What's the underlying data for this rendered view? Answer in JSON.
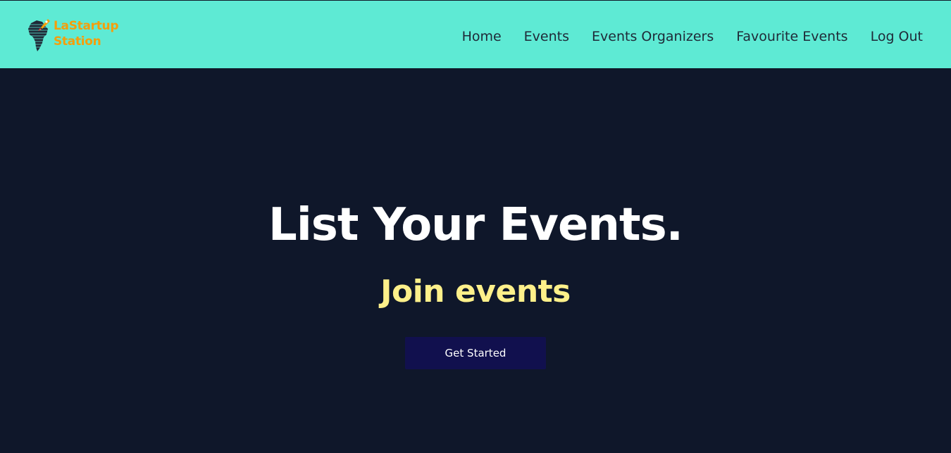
{
  "brand": {
    "name_line1": "LaStartup",
    "name_line2": "Station",
    "logo_icon": "africa-rocket-icon",
    "accent_color": "#f59e0b"
  },
  "nav": {
    "background_color": "#5eead4",
    "links": [
      {
        "label": "Home"
      },
      {
        "label": "Events"
      },
      {
        "label": "Events Organizers"
      },
      {
        "label": "Favourite Events"
      },
      {
        "label": "Log Out"
      }
    ]
  },
  "hero": {
    "background_color": "#0f172a",
    "title": "List Your Events.",
    "subtitle": "Join events",
    "subtitle_color": "#fef08a",
    "cta_label": "Get Started",
    "cta_color": "#11104e"
  }
}
